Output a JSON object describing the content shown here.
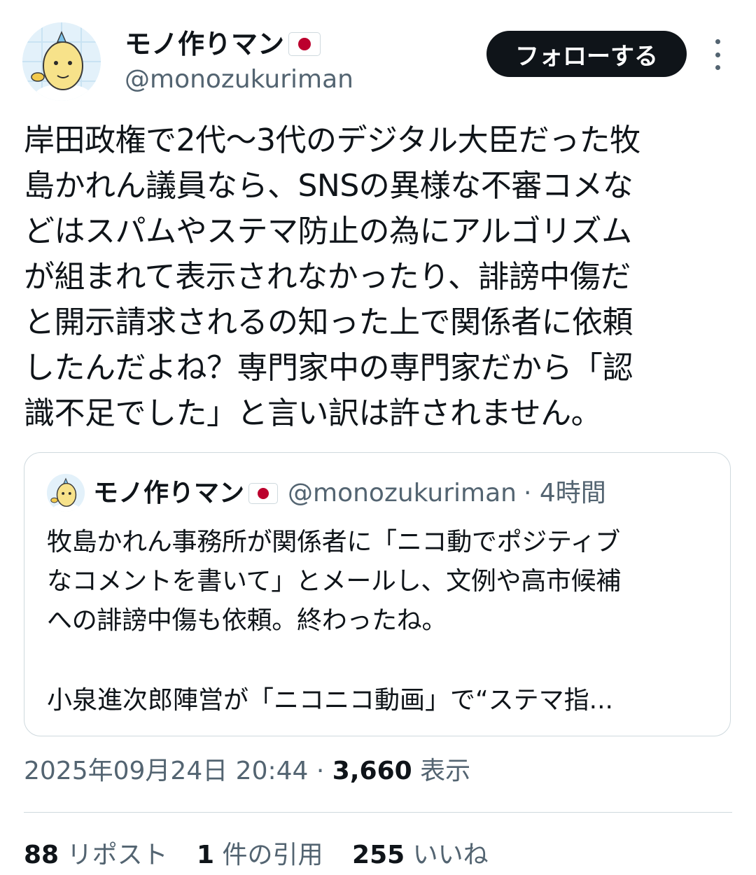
{
  "author": {
    "display_name": "モノ作りマン",
    "handle": "@monozukuriman",
    "flag_icon": "japan-flag-icon",
    "follow_label": "フォローする"
  },
  "tweet": {
    "text": "岸田政権で2代〜3代のデジタル大臣だった牧\n島かれん議員なら、SNSの異様な不審コメな\nどはスパムやステマ防止の為にアルゴリズム\nが組まれて表示されなかったり、誹謗中傷だ\nと開示請求されるの知った上で関係者に依頼\nしたんだよね？専門家中の専門家だから「認\n識不足でした」と言い訳は許されません。"
  },
  "quote": {
    "display_name": "モノ作りマン",
    "handle": "@monozukuriman",
    "time": "· 4時間",
    "text": "牧島かれん事務所が関係者に「ニコ動でポジティブ\nなコメントを書いて」とメールし、文例や高市候補\nへの誹謗中傷も依頼。終わったね。",
    "text2": "小泉進次郎陣営が「ニコニコ動画」で“ステマ指..."
  },
  "meta": {
    "timestamp": "2025年09月24日 20:44",
    "separator": "·",
    "views": "3,660",
    "views_label": "表示"
  },
  "stats": {
    "reposts": "88",
    "reposts_label": "リポスト",
    "quotes": "1",
    "quotes_label": "件の引用",
    "likes": "255",
    "likes_label": "いいね"
  },
  "colors": {
    "text": "#0f1419",
    "secondary": "#536471",
    "border": "#cfd9de",
    "follow_bg": "#0f1419",
    "flag_red": "#bc002d"
  }
}
